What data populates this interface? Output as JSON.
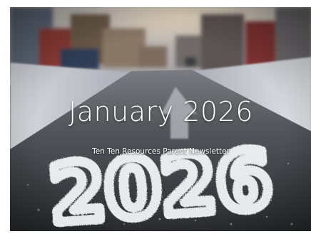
{
  "newsletter": {
    "month_title": "January 2026",
    "subtitle": "Ten Ten Resources Parent Newsletter",
    "road_snow_number": "2026"
  }
}
